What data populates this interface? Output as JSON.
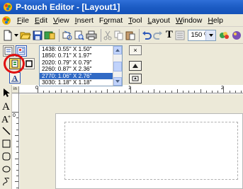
{
  "window": {
    "title": "P-touch Editor - [Layout1]",
    "app_icon": "ptouch-app-icon"
  },
  "menu": {
    "items": [
      {
        "u": "F",
        "rest": "ile"
      },
      {
        "u": "E",
        "rest": "dit"
      },
      {
        "u": "V",
        "rest": "iew"
      },
      {
        "u": "I",
        "rest": "nsert"
      },
      {
        "pre": "F",
        "u": "o",
        "rest": "rmat"
      },
      {
        "u": "T",
        "rest": "ool"
      },
      {
        "pre": "",
        "u": "L",
        "rest": "ayout"
      },
      {
        "u": "W",
        "rest": "indow"
      },
      {
        "u": "H",
        "rest": "elp"
      }
    ]
  },
  "toolbar": {
    "zoom_value": "150 %",
    "text_tool": "T"
  },
  "label_sizes": {
    "items": [
      "1438: 0.55\" X 1.50\"",
      "1850: 0.71\" X 1.97\"",
      "2020: 0.79\" X 0.79\"",
      "2260: 0.87\" X 2.36\"",
      "2770: 1.06\" X 2.76\"",
      "3030: 1.18\" X 1.18\""
    ],
    "selected_index": 4
  },
  "panel": {
    "close_label": "×"
  },
  "ruler": {
    "corner_label": "in",
    "top_marks": [
      "0",
      "1",
      "2"
    ],
    "left_marks": [
      "0"
    ]
  },
  "colors": {
    "title_bar": "#1c5cc4",
    "selection": "#316ac5",
    "callout": "#e01010",
    "chrome": "#ece9d8"
  }
}
